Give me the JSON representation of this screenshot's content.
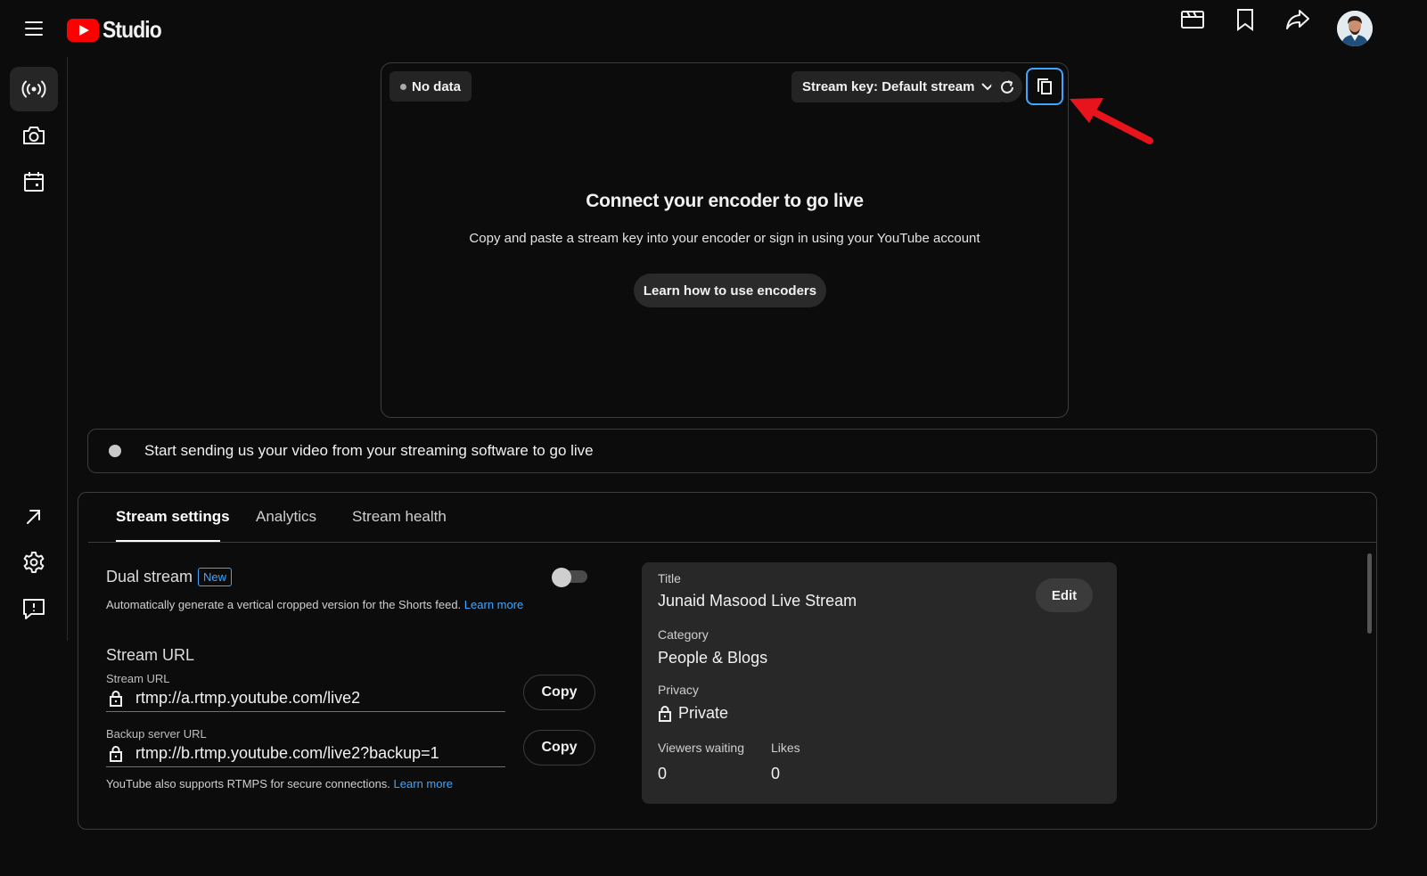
{
  "app": {
    "logo_text": "Studio"
  },
  "header": {
    "icons": [
      "clapperboard-icon",
      "bookmark-icon",
      "share-icon"
    ],
    "avatar": "profile-avatar"
  },
  "sidebar": {
    "items": [
      {
        "name": "live-icon",
        "active": true
      },
      {
        "name": "camera-icon",
        "active": false
      },
      {
        "name": "calendar-icon",
        "active": false
      },
      {
        "name": "external-link-icon",
        "active": false
      },
      {
        "name": "gear-icon",
        "active": false
      },
      {
        "name": "feedback-icon",
        "active": false
      }
    ]
  },
  "preview": {
    "status_label": "No data",
    "stream_key_label": "Stream key: Default stream",
    "title": "Connect your encoder to go live",
    "subtitle": "Copy and paste a stream key into your encoder or sign in using your YouTube account",
    "learn_button": "Learn how to use encoders"
  },
  "status_bar": {
    "text": "Start sending us your video from your streaming software to go live"
  },
  "tabs": [
    {
      "label": "Stream settings",
      "active": true
    },
    {
      "label": "Analytics",
      "active": false
    },
    {
      "label": "Stream health",
      "active": false
    }
  ],
  "settings": {
    "dual_stream_label": "Dual stream",
    "new_badge": "New",
    "dual_stream_enabled": false,
    "dual_stream_desc": "Automatically generate a vertical cropped version for the Shorts feed.",
    "learn_more": "Learn more",
    "stream_url_heading": "Stream URL",
    "stream_url_label": "Stream URL",
    "stream_url_value": "rtmp://a.rtmp.youtube.com/live2",
    "backup_url_label": "Backup server URL",
    "backup_url_value": "rtmp://b.rtmp.youtube.com/live2?backup=1",
    "copy_label": "Copy",
    "rtmps_note": "YouTube also supports RTMPS for secure connections."
  },
  "info_card": {
    "title_label": "Title",
    "title_value": "Junaid Masood Live Stream",
    "edit_label": "Edit",
    "category_label": "Category",
    "category_value": "People & Blogs",
    "privacy_label": "Privacy",
    "privacy_value": "Private",
    "viewers_label": "Viewers waiting",
    "viewers_value": "0",
    "likes_label": "Likes",
    "likes_value": "0"
  },
  "colors": {
    "accent": "#3ea6ff",
    "brand_red": "#ff0000",
    "annotation_arrow": "#e8141c"
  }
}
